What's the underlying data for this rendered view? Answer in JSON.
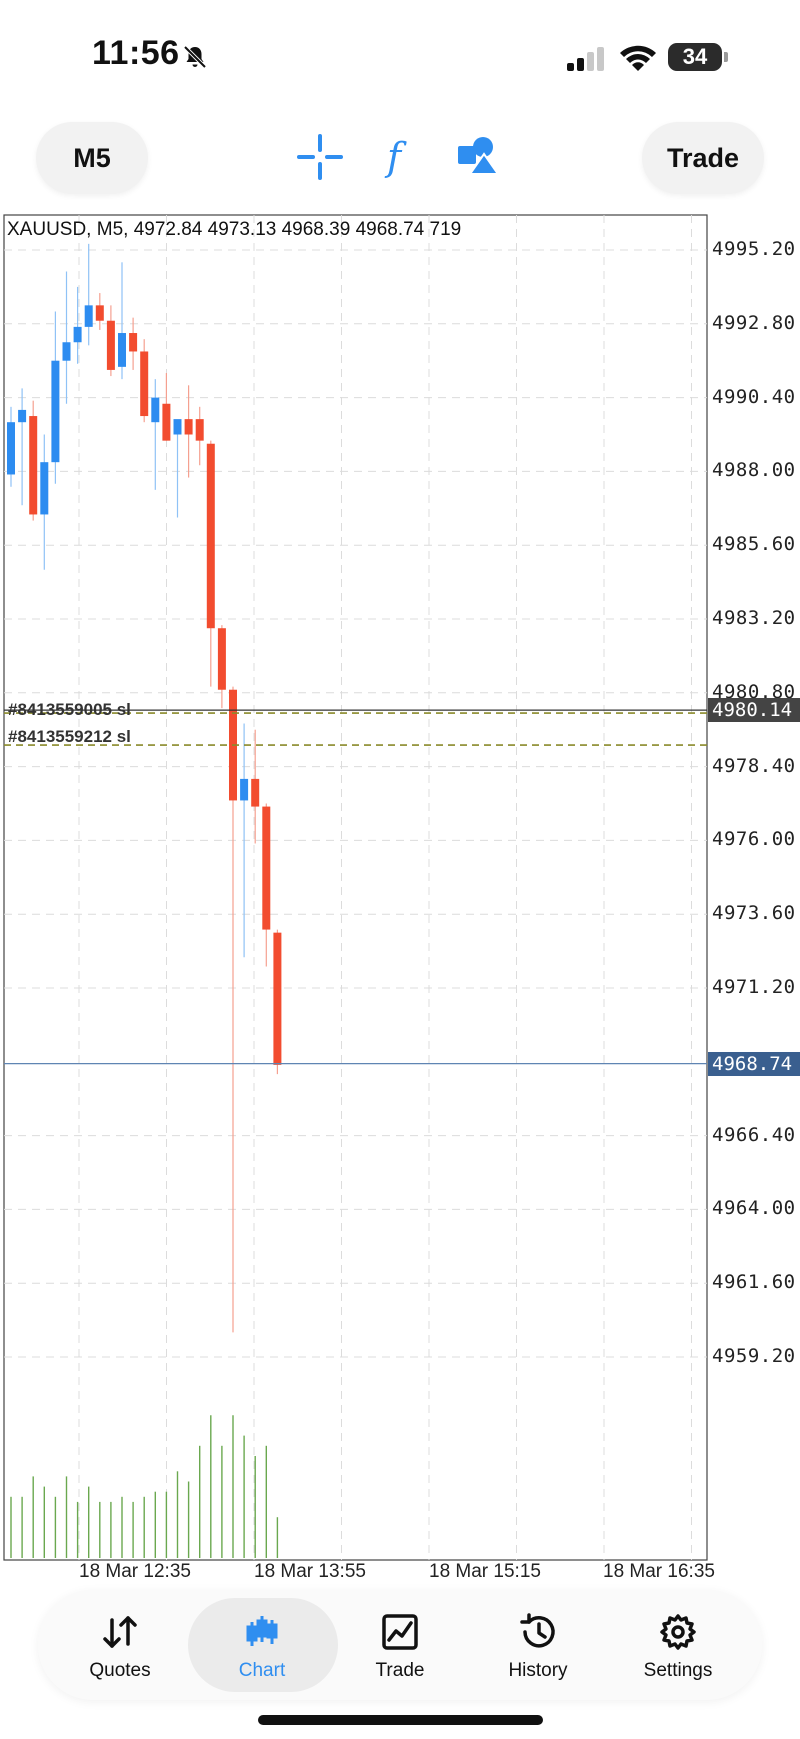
{
  "status_bar": {
    "time": "11:56",
    "battery": "34"
  },
  "toolbar": {
    "timeframe": "M5",
    "trade_label": "Trade",
    "icons": [
      "crosshair-icon",
      "indicators-f-icon",
      "objects-shapes-icon"
    ]
  },
  "chart": {
    "info": "XAUUSD, M5, 4972.84 4973.13 4968.39 4968.74 719",
    "price_scale": [
      "4995.20",
      "4992.80",
      "4990.40",
      "4988.00",
      "4985.60",
      "4983.20",
      "4980.80",
      "4978.40",
      "4976.00",
      "4973.60",
      "4971.20",
      "4966.40",
      "4964.00",
      "4961.60",
      "4959.20"
    ],
    "bid_tag": "4980.14",
    "last_tag": "4968.74",
    "time_axis": [
      "18 Mar 12:35",
      "18 Mar 13:55",
      "18 Mar 15:15",
      "18 Mar 16:35"
    ],
    "order_labels": [
      "#8413559005 sl",
      "#8413559212 sl"
    ],
    "colors": {
      "bull": "#2d8cf0",
      "bear": "#f24c2f",
      "volume": "#6aa84f",
      "bid_tag_bg": "#444444",
      "last_tag_bg": "#3a5f8f"
    }
  },
  "chart_data": {
    "type": "candlestick",
    "symbol": "XAUUSD",
    "timeframe": "M5",
    "ylim": [
      4957.5,
      4996.5
    ],
    "candles": [
      {
        "o": 4987.9,
        "h": 4990.1,
        "l": 4987.5,
        "c": 4989.6
      },
      {
        "o": 4989.6,
        "h": 4990.7,
        "l": 4986.9,
        "c": 4990.0
      },
      {
        "o": 4989.8,
        "h": 4990.3,
        "l": 4986.4,
        "c": 4986.6
      },
      {
        "o": 4986.6,
        "h": 4989.2,
        "l": 4984.8,
        "c": 4988.3
      },
      {
        "o": 4988.3,
        "h": 4993.2,
        "l": 4987.6,
        "c": 4991.6
      },
      {
        "o": 4991.6,
        "h": 4994.5,
        "l": 4990.2,
        "c": 4992.2
      },
      {
        "o": 4992.2,
        "h": 4994.0,
        "l": 4991.5,
        "c": 4992.7
      },
      {
        "o": 4992.7,
        "h": 4995.4,
        "l": 4992.1,
        "c": 4993.4
      },
      {
        "o": 4993.4,
        "h": 4993.8,
        "l": 4992.6,
        "c": 4992.9
      },
      {
        "o": 4992.9,
        "h": 4993.4,
        "l": 4991.1,
        "c": 4991.3
      },
      {
        "o": 4991.4,
        "h": 4994.8,
        "l": 4991.0,
        "c": 4992.5
      },
      {
        "o": 4992.5,
        "h": 4993.0,
        "l": 4991.3,
        "c": 4991.9
      },
      {
        "o": 4991.9,
        "h": 4992.3,
        "l": 4989.6,
        "c": 4989.8
      },
      {
        "o": 4989.6,
        "h": 4991.0,
        "l": 4987.4,
        "c": 4990.4
      },
      {
        "o": 4990.2,
        "h": 4991.2,
        "l": 4989.0,
        "c": 4989.0
      },
      {
        "o": 4989.2,
        "h": 4989.6,
        "l": 4986.5,
        "c": 4989.7
      },
      {
        "o": 4989.7,
        "h": 4990.8,
        "l": 4987.8,
        "c": 4989.2
      },
      {
        "o": 4989.7,
        "h": 4990.1,
        "l": 4988.2,
        "c": 4989.0
      },
      {
        "o": 4988.9,
        "h": 4989.0,
        "l": 4981.0,
        "c": 4982.9
      },
      {
        "o": 4982.9,
        "h": 4983.0,
        "l": 4980.3,
        "c": 4980.9
      },
      {
        "o": 4980.9,
        "h": 4981.0,
        "l": 4960.0,
        "c": 4977.3
      },
      {
        "o": 4977.3,
        "h": 4979.8,
        "l": 4972.2,
        "c": 4978.0
      },
      {
        "o": 4978.0,
        "h": 4979.6,
        "l": 4975.9,
        "c": 4977.1
      },
      {
        "o": 4977.1,
        "h": 4977.2,
        "l": 4971.9,
        "c": 4973.1
      },
      {
        "o": 4973.0,
        "h": 4973.1,
        "l": 4968.4,
        "c": 4968.7
      }
    ],
    "volumes": [
      60,
      60,
      80,
      70,
      60,
      80,
      55,
      70,
      55,
      55,
      60,
      55,
      60,
      65,
      65,
      85,
      75,
      110,
      140,
      110,
      140,
      120,
      100,
      110,
      40
    ],
    "order_levels": [
      {
        "label": "#8413559005 sl",
        "price": 4980.14
      },
      {
        "label": "#8413559212 sl",
        "price": 4979.1
      }
    ],
    "last_price": 4968.74,
    "grid": true
  },
  "nav": {
    "items": [
      {
        "label": "Quotes",
        "icon": "quotes-arrows-icon"
      },
      {
        "label": "Chart",
        "icon": "chart-candles-icon"
      },
      {
        "label": "Trade",
        "icon": "trade-chart-icon"
      },
      {
        "label": "History",
        "icon": "history-clock-icon"
      },
      {
        "label": "Settings",
        "icon": "settings-gear-icon"
      }
    ],
    "active": "Chart"
  }
}
